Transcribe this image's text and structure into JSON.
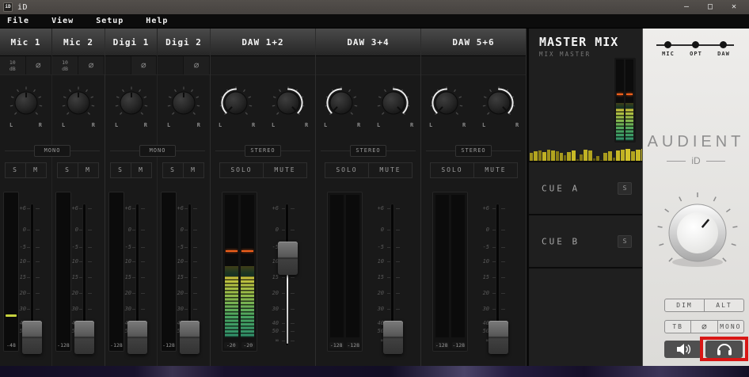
{
  "titlebar": {
    "icon_text": "iD",
    "title": "iD",
    "minimize": "–",
    "maximize": "□",
    "close": "✕"
  },
  "menubar": {
    "items": [
      "File",
      "View",
      "Setup",
      "Help"
    ]
  },
  "links": {
    "mono": "MONO",
    "stereo": "STEREO"
  },
  "pan": {
    "left": "L",
    "right": "R"
  },
  "fader_scale": [
    "+6",
    "0",
    "-5",
    "10",
    "15",
    "20",
    "30",
    "40",
    "50",
    "∞"
  ],
  "strips": {
    "mic1": {
      "name": "Mic 1",
      "gain_top": "10",
      "gain_bottom": "dB",
      "phase": "∅",
      "solo": "S",
      "mute": "M",
      "readout": "-48"
    },
    "mic2": {
      "name": "Mic 2",
      "gain_top": "10",
      "gain_bottom": "dB",
      "phase": "∅",
      "solo": "S",
      "mute": "M",
      "readout": "-128"
    },
    "digi1": {
      "name": "Digi 1",
      "phase": "∅",
      "solo": "S",
      "mute": "M",
      "readout": "-128"
    },
    "digi2": {
      "name": "Digi 2",
      "phase": "∅",
      "solo": "S",
      "mute": "M",
      "readout": "-128"
    },
    "daw12": {
      "name": "DAW 1+2",
      "solo": "SOLO",
      "mute": "MUTE",
      "readout_l": "-20",
      "readout_r": "-20"
    },
    "daw34": {
      "name": "DAW 3+4",
      "solo": "SOLO",
      "mute": "MUTE",
      "readout_l": "-128",
      "readout_r": "-128"
    },
    "daw56": {
      "name": "DAW 5+6",
      "solo": "SOLO",
      "mute": "MUTE",
      "readout_l": "-128",
      "readout_r": "-128"
    }
  },
  "master": {
    "title": "MASTER MIX",
    "subtitle": "MIX MASTER",
    "cue_a_label": "CUE A",
    "cue_a_solo": "S",
    "cue_b_label": "CUE B",
    "cue_b_solo": "S"
  },
  "monitor": {
    "inputs": [
      "MIC",
      "OPT",
      "DAW"
    ],
    "brand": "AUDIENT",
    "model": "iD",
    "dim": "DIM",
    "alt": "ALT",
    "tb": "TB",
    "phase": "∅",
    "mono": "MONO"
  },
  "colors": {
    "peak_orange": "#ef5f1b",
    "meter_green": "#4aa45f",
    "meter_yellow": "#c9c13b",
    "signal_green": "#c6d23e",
    "annotation_red": "#d81715",
    "titlebar": "#4a4643",
    "monitor_panel": "#e8e7e4"
  }
}
